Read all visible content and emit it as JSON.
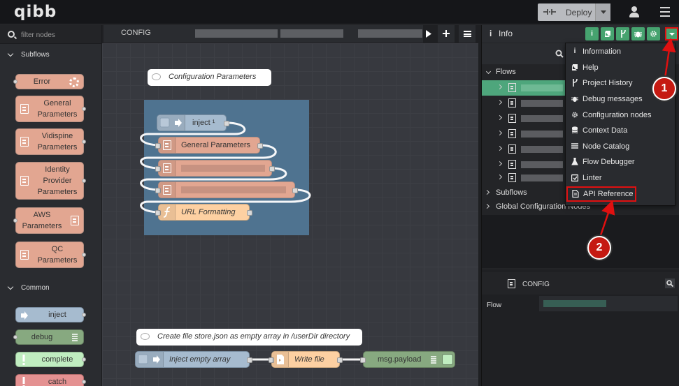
{
  "header": {
    "logo": "qibb",
    "deploy_label": "Deploy"
  },
  "palette": {
    "search_placeholder": "filter nodes",
    "categories": [
      {
        "label": "Subflows"
      },
      {
        "label": "Common"
      }
    ],
    "subflow_nodes": [
      {
        "label": "Error"
      },
      {
        "label": "General Parameters"
      },
      {
        "label": "Vidispine Parameters"
      },
      {
        "label": "Identity Provider Parameters"
      },
      {
        "label": "AWS Parameters"
      },
      {
        "label": "QC Parameters"
      }
    ],
    "common_nodes": [
      {
        "label": "inject"
      },
      {
        "label": "debug"
      },
      {
        "label": "complete"
      },
      {
        "label": "catch"
      }
    ]
  },
  "workspace": {
    "tab_label": "CONFIG",
    "comments": [
      {
        "text": "Configuration Parameters"
      },
      {
        "text": "Create file store.json as empty array in /userDir directory"
      }
    ],
    "group_nodes": [
      {
        "label": "inject ¹"
      },
      {
        "label": "General Parameters"
      },
      {
        "label": "URL Formatting"
      }
    ],
    "flow_nodes": [
      {
        "label": "Inject empty array"
      },
      {
        "label": "Write file"
      },
      {
        "label": "msg.payload"
      }
    ]
  },
  "sidebar": {
    "title": "Info",
    "info_icon": "i",
    "tree": [
      {
        "label": "Flows"
      },
      {
        "label": "Subflows"
      },
      {
        "label": "Global Configuration Nodes"
      }
    ],
    "selected_title": "CONFIG",
    "flow_label": "Flow"
  },
  "dropdown_menu": {
    "items": [
      {
        "label": "Information",
        "icon": "info-icon"
      },
      {
        "label": "Help",
        "icon": "book-icon"
      },
      {
        "label": "Project History",
        "icon": "git-icon"
      },
      {
        "label": "Debug messages",
        "icon": "bug-icon"
      },
      {
        "label": "Configuration nodes",
        "icon": "gear-icon"
      },
      {
        "label": "Context Data",
        "icon": "database-icon"
      },
      {
        "label": "Node Catalog",
        "icon": "list-icon"
      },
      {
        "label": "Flow Debugger",
        "icon": "flask-icon"
      },
      {
        "label": "Linter",
        "icon": "linter-icon"
      },
      {
        "label": "API Reference",
        "icon": "file-icon"
      }
    ]
  },
  "annotations": {
    "marker_1": "1",
    "marker_2": "2"
  },
  "colors": {
    "accent": "#46a36f",
    "annotation_red": "#e01010",
    "subflow_node": "#e2a691",
    "group": "#4f7390"
  }
}
